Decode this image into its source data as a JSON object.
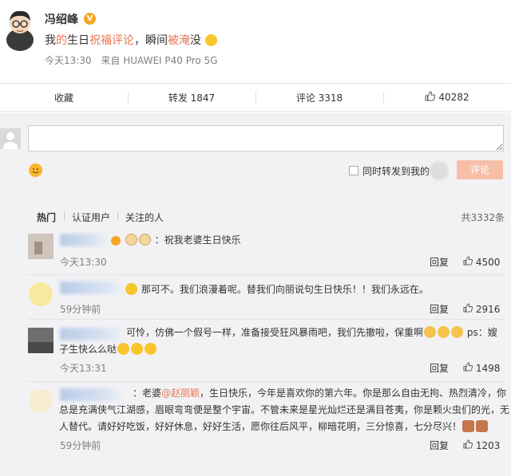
{
  "post": {
    "author": "冯绍峰",
    "verified_badge": "V",
    "text_parts": [
      "我",
      "的",
      "生日",
      "祝福评论",
      "，瞬间",
      "被淹",
      "没"
    ],
    "time": "今天13:30",
    "source": "来自 HUAWEI P40 Pro 5G"
  },
  "actions": {
    "favorite": "收藏",
    "repost": "转发 1847",
    "comment": "评论 3318",
    "likes": "40282"
  },
  "compose": {
    "placeholder": "",
    "repost_label": "同时转发到我的",
    "submit_label": "评论"
  },
  "tabs": {
    "hot": "热门",
    "verified": "认证用户",
    "following": "关注的人",
    "total": "共3332条"
  },
  "comments": [
    {
      "text": "：祝我老婆生日快乐",
      "time": "今天13:30",
      "reply": "回复",
      "likes": "4500"
    },
    {
      "text": "那可不。我们浪漫着呢。替我们向丽说句生日快乐！！我们永远在。",
      "time": "59分钟前",
      "reply": "回复",
      "likes": "2916"
    },
    {
      "text_line1": "可怜，仿佛一个假号一样，准备接受狂风暴雨吧，我们先撤啦，保重啊",
      "text_tail": "ps：嫂",
      "text_line2": "子生快么么哒",
      "time": "今天13:31",
      "reply": "回复",
      "likes": "1498"
    },
    {
      "prefix": "：老婆",
      "mention": "@赵丽颖",
      "line1": "，生日快乐，今年是喜欢你的第六年。你是那么自由无拘、热烈清冷，你",
      "line2": "总是充满侠气江湖感，眉眼弯弯便是整个宇宙。不管未来是星光灿烂还是满目苍夷，你是颗火虫们的光，无",
      "line3": "人替代。请好好吃饭，好好休息，好好生活，愿你往后风平，柳暗花明，三分惊喜，七分尽兴！",
      "time": "59分钟前",
      "reply": "回复",
      "likes": "1203"
    }
  ],
  "colors": {
    "accent": "#eb7350",
    "background": "#f2f2f5",
    "submit_disabled": "#f7bfa7",
    "badge": "#f5a623"
  }
}
